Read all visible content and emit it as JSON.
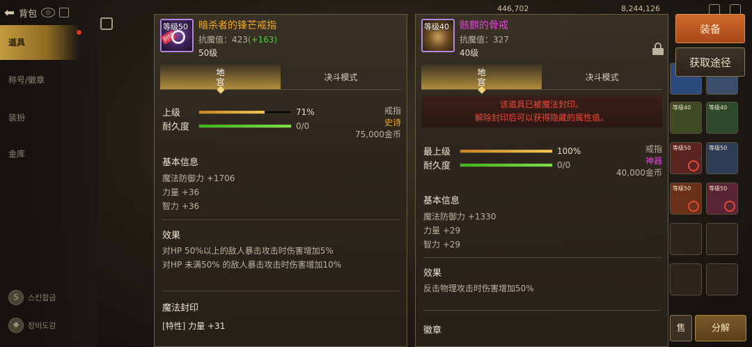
{
  "topbar": {
    "title": "背包",
    "eye": "◎"
  },
  "sidebar": {
    "items": [
      {
        "label": "道具"
      },
      {
        "label": "称号/徽章"
      },
      {
        "label": "装扮"
      },
      {
        "label": "金库"
      }
    ],
    "bottom": [
      {
        "label": "스킨합금",
        "icon": "S"
      },
      {
        "label": "장비도감",
        "icon": "❖"
      }
    ]
  },
  "currency": {
    "a": "446,702",
    "b": "8,244,126"
  },
  "actions": {
    "equip": "装备",
    "source": "获取途径",
    "bottom_left": "售",
    "bottom_right": "分解"
  },
  "right_slots": [
    {
      "label": ""
    },
    {
      "label": ""
    },
    {
      "label": "等级40"
    },
    {
      "label": "等级40"
    },
    {
      "label": "等级50"
    },
    {
      "label": "等级50"
    },
    {
      "label": "等级50"
    },
    {
      "label": "等级50"
    }
  ],
  "left_item": {
    "level_tag": "等级50",
    "seal_tag": "封印",
    "name": "暗杀者的锋芒戒指",
    "name_color": "#f2a823",
    "stat_label": "抗魔值：423",
    "stat_bonus": "(+163)",
    "level": "50级",
    "tabs": [
      "地宫",
      "决斗模式"
    ],
    "grade_label": "上级",
    "grade_value": "71%",
    "grade_pct": 0.71,
    "durability_label": "耐久度",
    "durability_value": "0/0",
    "durability_pct": 1.0,
    "type": "戒指",
    "rarity": "史诗",
    "price": "75,000金币",
    "basic_title": "基本信息",
    "basic_stats": [
      "魔法防御力 +1706",
      "力量 +36",
      "智力 +36"
    ],
    "effect_title": "效果",
    "effects": [
      "对HP 50%以上的敌人暴击攻击时伤害增加5%",
      "对HP 未满50% 的敌人暴击攻击时伤害增加10%"
    ],
    "seal_title": "魔法封印",
    "special_tag": "[特性]",
    "special_value": " 力量 +31"
  },
  "right_item": {
    "level_tag": "等级40",
    "name": "骸麒的骨戒",
    "name_color": "#e83fe0",
    "stat_label": "抗魔值：327",
    "level": "40级",
    "tabs": [
      "地宫",
      "决斗模式"
    ],
    "sealed_lines": [
      "该道具已被魔法封印。",
      "解除封印后可以获得隐藏的属性值。"
    ],
    "grade_label": "最上级",
    "grade_value": "100%",
    "grade_pct": 1.0,
    "durability_label": "耐久度",
    "durability_value": "0/0",
    "durability_pct": 1.0,
    "type": "戒指",
    "rarity": "神器",
    "price": "40,000金币",
    "basic_title": "基本信息",
    "basic_stats": [
      "魔法防御力 +1330",
      "力量 +29",
      "智力 +29"
    ],
    "effect_title": "效果",
    "effects": [
      "反击物理攻击时伤害增加50%"
    ],
    "more_title": "徽章"
  }
}
